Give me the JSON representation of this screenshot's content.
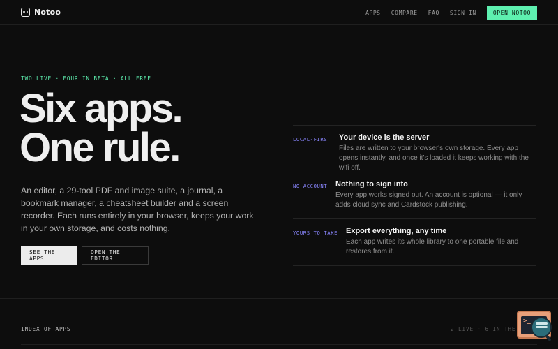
{
  "nav": {
    "brand": "Notoo",
    "links": [
      "APPS",
      "COMPARE",
      "FAQ",
      "SIGN IN"
    ],
    "cta": "OPEN NOTOO"
  },
  "hero": {
    "eyebrow": "TWO LIVE · FOUR IN BETA · ALL FREE",
    "headline_line1": "Six apps.",
    "headline_line2": "One rule.",
    "lede": "An editor, a 29-tool PDF and image suite, a journal, a bookmark manager, a cheatsheet builder and a screen recorder. Each runs entirely in your browser, keeps your work in your own storage, and costs nothing.",
    "primary_button": "SEE THE APPS",
    "secondary_button": "OPEN THE EDITOR"
  },
  "features": [
    {
      "tag": "LOCAL-FIRST",
      "title": "Your device is the server",
      "desc": "Files are written to your browser's own storage. Every app opens instantly, and once it's loaded it keeps working with the wifi off."
    },
    {
      "tag": "NO ACCOUNT",
      "title": "Nothing to sign into",
      "desc": "Every app works signed out. An account is optional — it only adds cloud sync and Cardstock publishing."
    },
    {
      "tag": "YOURS TO TAKE",
      "title": "Export everything, any time",
      "desc": "Each app writes its whole library to one portable file and restores from it."
    }
  ],
  "index": {
    "label": "INDEX OF APPS",
    "count": "2 LIVE · 6 IN THE"
  },
  "colors": {
    "accent": "#5ef0b0",
    "tag": "#8a86ff",
    "background": "#0d0d0d"
  },
  "icons": {
    "brand": "notoo-logo-icon",
    "widget": "terminal-search-icon"
  }
}
